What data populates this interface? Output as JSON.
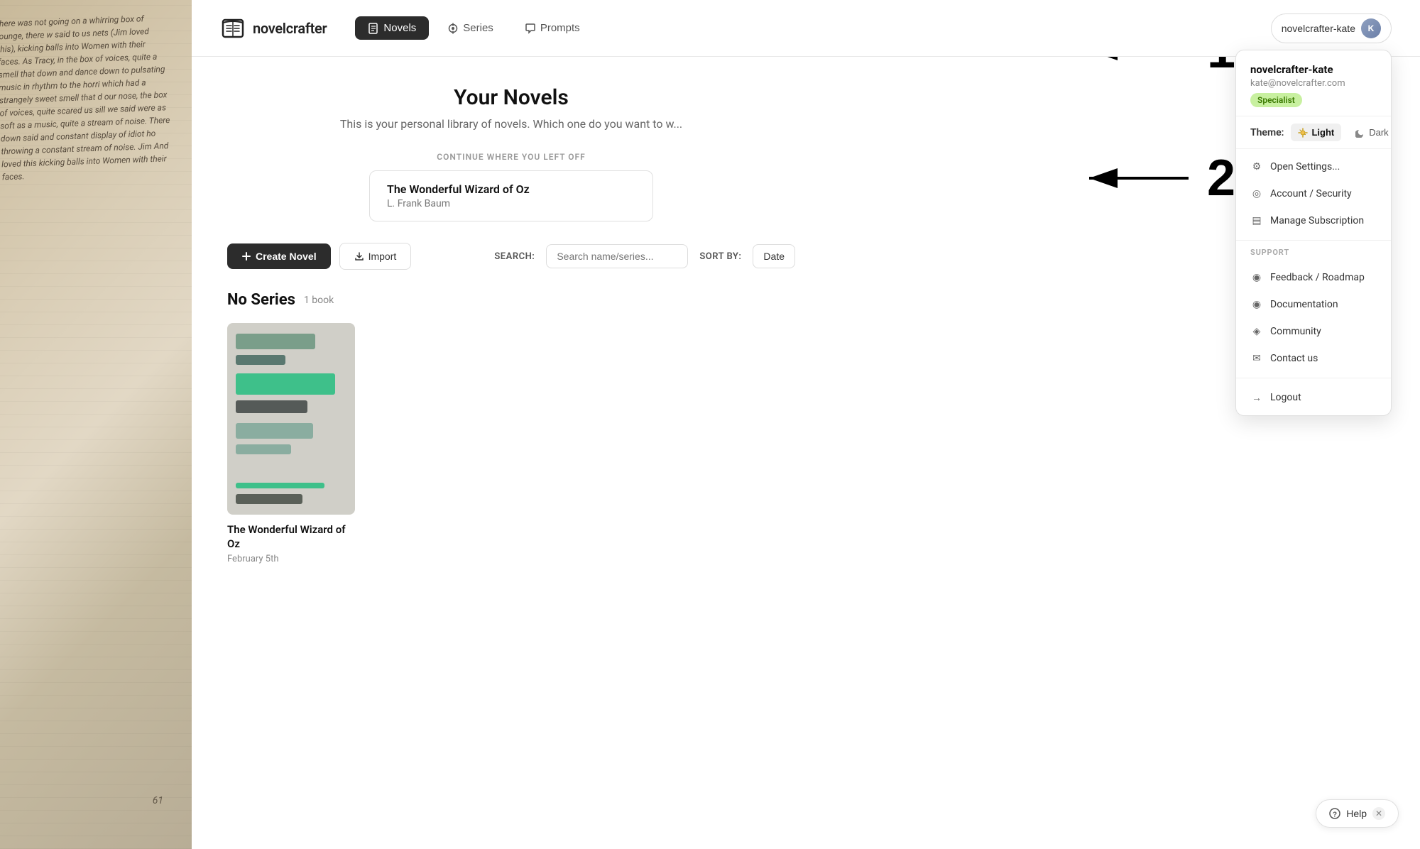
{
  "brand": {
    "name": "novelcrafter",
    "logo_alt": "book icon"
  },
  "nav": {
    "novels_label": "Novels",
    "series_label": "Series",
    "prompts_label": "Prompts",
    "novels_icon": "book-icon",
    "series_icon": "series-icon",
    "prompts_icon": "prompts-icon"
  },
  "user": {
    "username": "novelcrafter-kate",
    "email": "kate@novelcrafter.com",
    "badge": "Specialist"
  },
  "page": {
    "title": "Your Novels",
    "subtitle": "This is your personal library of novels. Which one do you want to w...",
    "continue_label": "CONTINUE WHERE YOU LEFT OFF",
    "novel_title": "The Wonderful Wizard of Oz",
    "novel_author": "L. Frank Baum"
  },
  "toolbar": {
    "create_label": "Create Novel",
    "import_label": "Import",
    "search_label": "SEARCH:",
    "search_placeholder": "Search name/series...",
    "sort_label": "SORT BY:",
    "sort_value": "Date"
  },
  "series_section": {
    "title": "No Series",
    "count": "1 book"
  },
  "novel_card": {
    "title": "The Wonderful Wizard of Oz",
    "date": "February 5th"
  },
  "dropdown": {
    "username": "novelcrafter-kate",
    "email": "kate@novelcrafter.com",
    "badge": "Specialist",
    "theme_label": "Theme:",
    "theme_light": "Light",
    "theme_dark": "Dark",
    "open_settings": "Open Settings...",
    "account_security": "Account / Security",
    "manage_subscription": "Manage Subscription",
    "support_label": "SUPPORT",
    "feedback_roadmap": "Feedback / Roadmap",
    "documentation": "Documentation",
    "community": "Community",
    "contact_us": "Contact us",
    "logout": "Logout"
  },
  "help": {
    "label": "Help"
  },
  "book_text": "there was not going on a whirring box of lounge, there w said to us nets (Jim loved this), kicking balls into Women with their faces. As Tracy, in the box of voices, quite a smell that down and dance down to pulsating music in rhythm to the horri which had a strangely sweet smell that d our nose, the box of voices, quite scared us sill we said were as soft as a music, quite a stream of noise. There down said and constant display of idiot ho throwing a constant stream of noise. Jim And loved this kicking balls into Women with their faces."
}
